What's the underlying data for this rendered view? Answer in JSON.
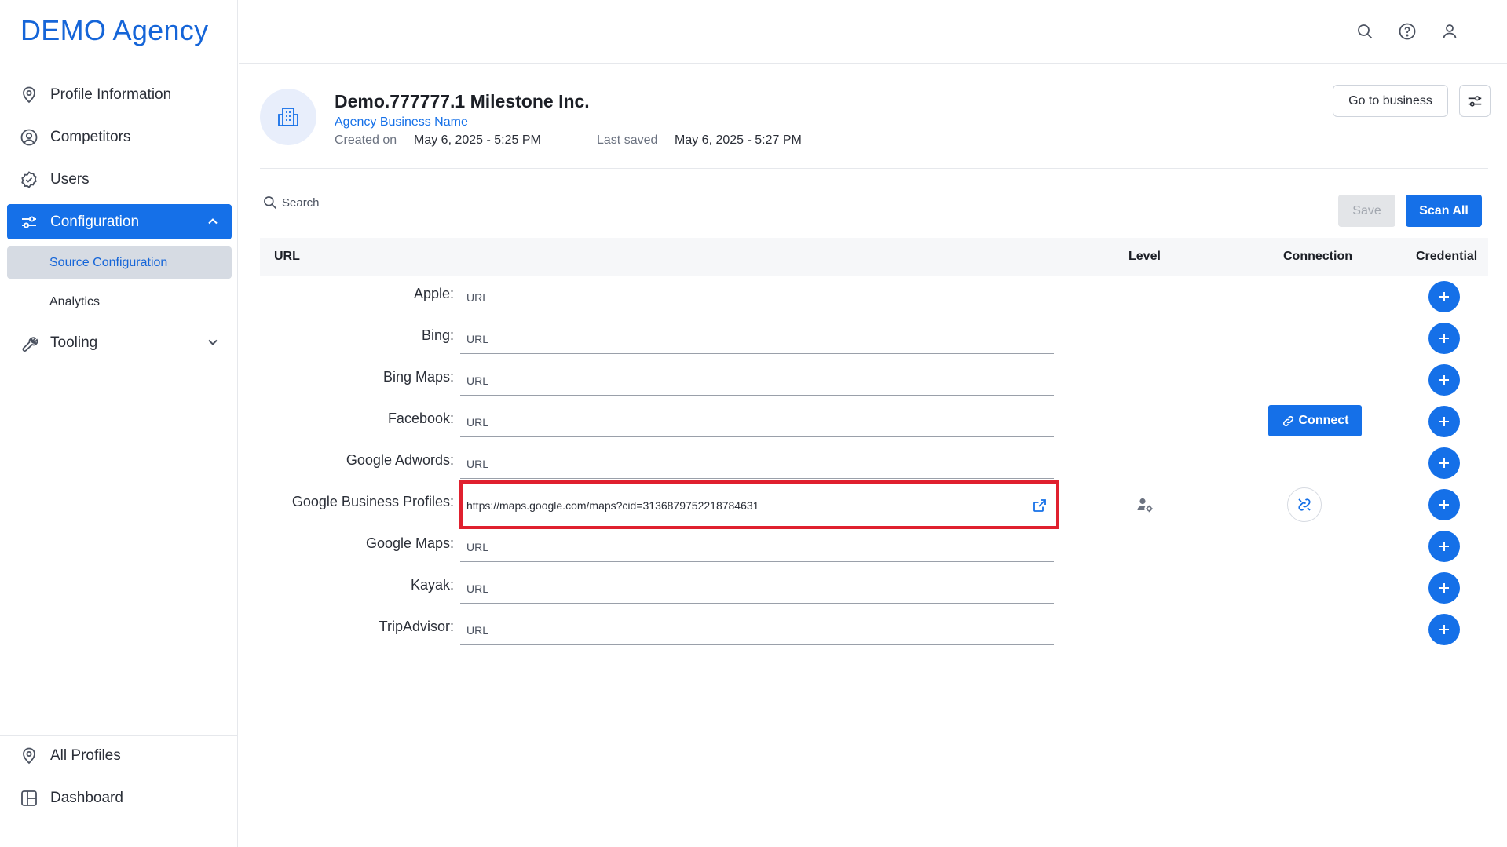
{
  "brand": "DEMO Agency",
  "sidebar": {
    "items": [
      {
        "label": "Profile Information",
        "icon": "location-pin-icon"
      },
      {
        "label": "Competitors",
        "icon": "user-circle-icon"
      },
      {
        "label": "Users",
        "icon": "check-badge-icon"
      },
      {
        "label": "Configuration",
        "icon": "sliders-icon",
        "active": true
      }
    ],
    "subitems": [
      {
        "label": "Source Configuration",
        "active": true
      },
      {
        "label": "Analytics"
      }
    ],
    "tooling": {
      "label": "Tooling",
      "icon": "wrench-icon"
    },
    "bottom": [
      {
        "label": "All Profiles",
        "icon": "location-pin-icon"
      },
      {
        "label": "Dashboard",
        "icon": "dashboard-icon"
      }
    ]
  },
  "header": {
    "title": "Demo.777777.1 Milestone Inc.",
    "subtitle": "Agency Business Name",
    "created_label": "Created on",
    "created_value": "May 6, 2025 - 5:25 PM",
    "saved_label": "Last saved",
    "saved_value": "May 6, 2025 - 5:27 PM",
    "go_to_business": "Go to business"
  },
  "toolbar": {
    "search_placeholder": "Search",
    "save_label": "Save",
    "scan_all_label": "Scan All"
  },
  "table": {
    "columns": {
      "url": "URL",
      "level": "Level",
      "connection": "Connection",
      "credential": "Credential"
    },
    "url_placeholder": "URL",
    "rows": [
      {
        "label": "Apple:",
        "value": ""
      },
      {
        "label": "Bing:",
        "value": ""
      },
      {
        "label": "Bing Maps:",
        "value": ""
      },
      {
        "label": "Facebook:",
        "value": "",
        "connection": "Connect"
      },
      {
        "label": "Google Adwords:",
        "value": ""
      },
      {
        "label": "Google Business Profiles:",
        "value": "https://maps.google.com/maps?cid=3136879752218784631",
        "highlighted": true
      },
      {
        "label": "Google Maps:",
        "value": ""
      },
      {
        "label": "Kayak:",
        "value": ""
      },
      {
        "label": "TripAdvisor:",
        "value": ""
      }
    ]
  },
  "colors": {
    "accent": "#1570e8",
    "highlight": "#e0202e"
  }
}
